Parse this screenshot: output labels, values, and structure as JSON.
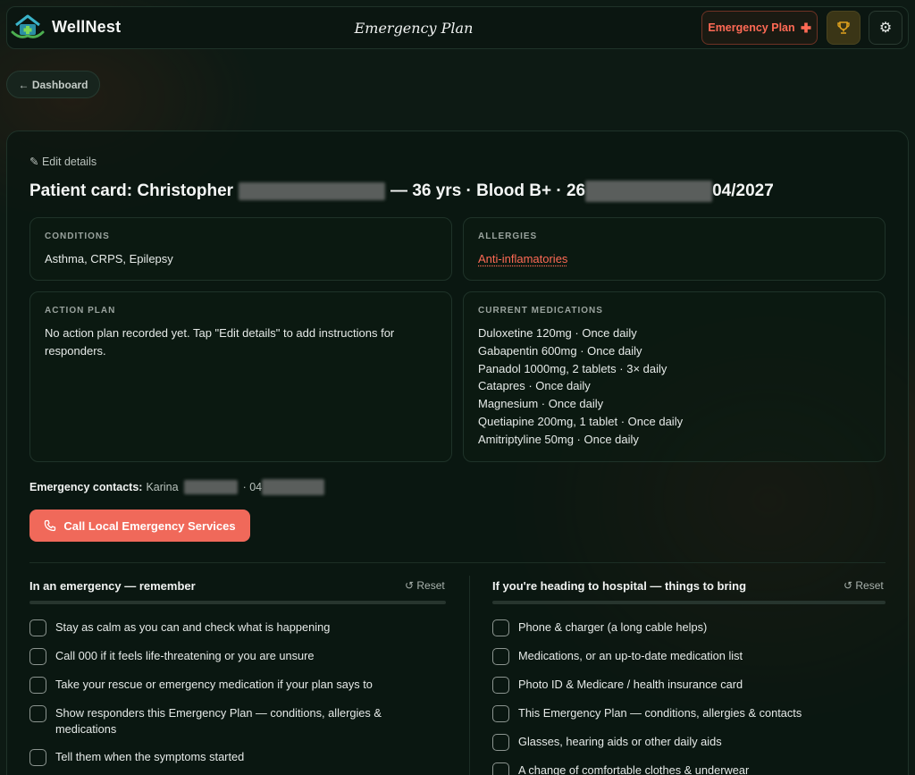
{
  "header": {
    "brand": "WellNest",
    "title": "Emergency Plan",
    "emergency_button": "Emergency Plan",
    "trophy_icon": "trophy-icon",
    "settings_icon": "gear-icon",
    "settings_glyph": "⚙"
  },
  "nav": {
    "back_label": "← Dashboard"
  },
  "card": {
    "edit_label": "✎ Edit details",
    "title_prefix": "Patient card: Christopher",
    "title_middle": "— 36 yrs · Blood B+ · 26",
    "title_suffix": "04/2027"
  },
  "conditions": {
    "label": "CONDITIONS",
    "value": "Asthma, CRPS, Epilepsy"
  },
  "allergies": {
    "label": "ALLERGIES",
    "value": "Anti-inflamatories"
  },
  "action_plan": {
    "label": "ACTION PLAN",
    "value": "No action plan recorded yet. Tap \"Edit details\" to add instructions for responders."
  },
  "medications": {
    "label": "CURRENT MEDICATIONS",
    "items": [
      "Duloxetine 120mg · Once daily",
      "Gabapentin 600mg · Once daily",
      "Panadol 1000mg, 2 tablets · 3× daily",
      "Catapres · Once daily",
      "Magnesium · Once daily",
      "Quetiapine 200mg, 1 tablet · Once daily",
      "Amitriptyline 50mg · Once daily"
    ]
  },
  "contacts": {
    "label": "Emergency contacts:",
    "name": "Karina",
    "separator": "· 04"
  },
  "call_button": "Call Local Emergency Services",
  "emergency_list": {
    "title": "In an emergency — remember",
    "reset": "↺ Reset",
    "items": [
      "Stay as calm as you can and check what is happening",
      "Call 000 if it feels life-threatening or you are unsure",
      "Take your rescue or emergency medication if your plan says to",
      "Show responders this Emergency Plan — conditions, allergies & medications",
      "Tell them when the symptoms started"
    ]
  },
  "hospital_list": {
    "title": "If you're heading to hospital — things to bring",
    "reset": "↺ Reset",
    "items": [
      "Phone & charger (a long cable helps)",
      "Medications, or an up-to-date medication list",
      "Photo ID & Medicare / health insurance card",
      "This Emergency Plan — conditions, allergies & contacts",
      "Glasses, hearing aids or other daily aids",
      "A change of comfortable clothes & underwear"
    ]
  },
  "colors": {
    "accent": "#ff6a55",
    "call_button": "#f0695a",
    "background": "#0d1a14"
  }
}
